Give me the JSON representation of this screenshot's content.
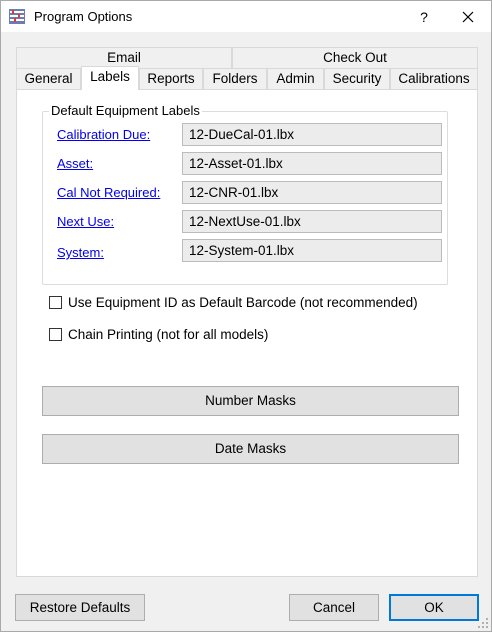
{
  "window": {
    "title": "Program Options",
    "help_label": "?",
    "icon": "app-settings-icon",
    "close_icon": "close-icon"
  },
  "tabs": {
    "row1": [
      {
        "label": "Email"
      },
      {
        "label": "Check Out"
      }
    ],
    "row2": [
      {
        "label": "General"
      },
      {
        "label": "Labels",
        "active": true
      },
      {
        "label": "Reports"
      },
      {
        "label": "Folders"
      },
      {
        "label": "Admin"
      },
      {
        "label": "Security"
      },
      {
        "label": "Calibrations"
      }
    ]
  },
  "labels_group": {
    "legend": "Default Equipment Labels",
    "rows": [
      {
        "link": "Calibration Due:",
        "file": "12-DueCal-01.lbx"
      },
      {
        "link": "Asset:",
        "file": "12-Asset-01.lbx"
      },
      {
        "link": "Cal Not Required:",
        "file": "12-CNR-01.lbx"
      },
      {
        "link": "Next Use:",
        "file": "12-NextUse-01.lbx"
      },
      {
        "link": "System:",
        "file": "12-System-01.lbx"
      }
    ]
  },
  "options": {
    "use_equipment_id": {
      "label": "Use Equipment ID as Default Barcode (not recommended)",
      "checked": false
    },
    "chain_printing": {
      "label": "Chain Printing (not for all models)",
      "checked": false
    }
  },
  "buttons": {
    "number_masks": "Number Masks",
    "date_masks": "Date Masks",
    "restore_defaults": "Restore Defaults",
    "cancel": "Cancel",
    "ok": "OK"
  },
  "colors": {
    "link": "#0000ee",
    "default_button_border": "#0078d7",
    "panel_bg": "#ffffff",
    "window_bg": "#f0f0f0"
  }
}
